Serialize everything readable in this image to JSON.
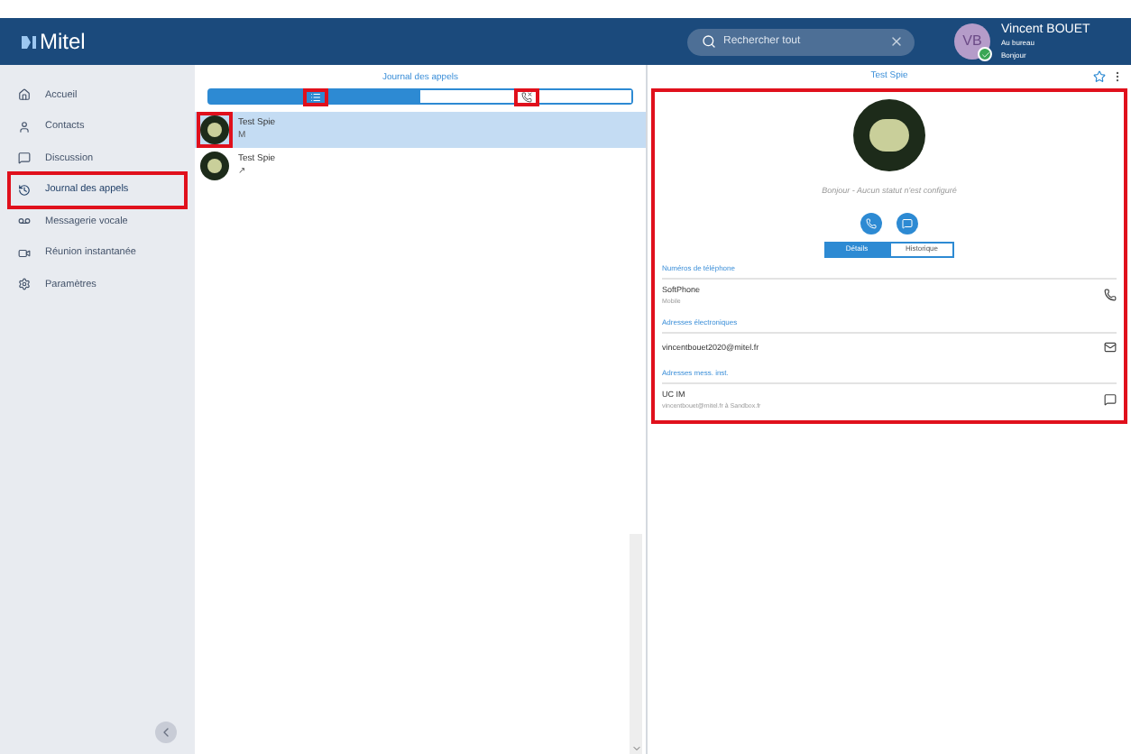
{
  "header": {
    "logo": "Mitel",
    "search": {
      "placeholder": "Rechercher tout"
    },
    "user": {
      "initials": "VB",
      "name": "Vincent BOUET",
      "status": "Au bureau",
      "note": "Bonjour"
    }
  },
  "sidebar": {
    "items": [
      {
        "label": "Accueil",
        "selected": false
      },
      {
        "label": "Contacts",
        "selected": false
      },
      {
        "label": "Discussion",
        "selected": false
      },
      {
        "label": "Journal des appels",
        "selected": true
      },
      {
        "label": "Messagerie vocale",
        "selected": false
      },
      {
        "label": "Réunion instantanée",
        "selected": false
      },
      {
        "label": "Paramètres",
        "selected": false
      }
    ]
  },
  "call_log": {
    "title": "Journal des appels",
    "filters": [
      {
        "selected": true
      },
      {
        "selected": false
      }
    ],
    "rows": [
      {
        "name": "Test Spie",
        "detail": "M",
        "selected": true
      },
      {
        "name": "Test Spie",
        "detail": "↗",
        "selected": false
      }
    ]
  },
  "contact": {
    "title": "Test Spie",
    "status": "Bonjour - Aucun statut n'est configuré",
    "tabs": [
      {
        "label": "Détails",
        "selected": true
      },
      {
        "label": "Historique",
        "selected": false
      }
    ],
    "sections": [
      {
        "title": "Numéros de téléphone",
        "entries": [
          {
            "value": "SoftPhone",
            "sub": "Mobile"
          }
        ]
      },
      {
        "title": "Adresses électroniques",
        "entries": [
          {
            "value": "vincentbouet2020@mitel.fr"
          }
        ]
      },
      {
        "title": "Adresses mess. inst.",
        "entries": [
          {
            "value": "UC IM",
            "sub": "vincentbouet@mitel.fr à Sandbox.fr"
          }
        ]
      }
    ]
  }
}
